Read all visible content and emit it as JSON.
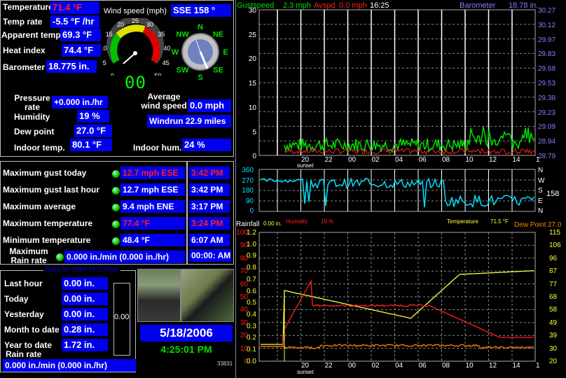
{
  "current": {
    "temperature_label": "Temperature",
    "temperature": "71.4 °F",
    "temp_rate_label": "Temp rate",
    "temp_rate": "-5.5 °F /hr",
    "apparent_label": "Apparent temp.",
    "apparent": "69.3 °F",
    "heat_index_label": "Heat index",
    "heat_index": "74.4 °F",
    "barometer_label": "Barometer",
    "barometer": "18.775 in.",
    "wind_speed_label": "Wind speed (mph)",
    "wind_dir": "SSE  158 °",
    "digital_speed": "00",
    "pressure_rate_label": "Pressure rate",
    "pressure_rate": "+0.000 in./hr",
    "humidity_label": "Humidity",
    "humidity": "19 %",
    "dew_point_label": "Dew point",
    "dew_point": "27.0 °F",
    "indoor_temp_label": "Indoor temp.",
    "indoor_temp": "80.1 °F",
    "avg_wind_label": "Average wind speed",
    "avg_wind": "0.0 mph",
    "windrun": "Windrun 22.9 miles",
    "indoor_hum_label": "Indoor hum.",
    "indoor_hum": "24 %"
  },
  "gauge": {
    "scale": [
      "0",
      "5",
      "10",
      "15",
      "20",
      "25",
      "30",
      "35",
      "40",
      "45",
      "50"
    ]
  },
  "compass": {
    "points": [
      "N",
      "NE",
      "E",
      "SE",
      "S",
      "SW",
      "W",
      "NW"
    ]
  },
  "extremes": [
    {
      "label": "Maximum gust today",
      "value": "12.7 mph ESE",
      "time": "3:42 PM",
      "red": true
    },
    {
      "label": "Maximum gust last hour",
      "value": "12.7 mph ESE",
      "time": "3:42 PM",
      "red": false
    },
    {
      "label": "Maximum average",
      "value": "9.4 mph ENE",
      "time": "3:17 PM",
      "red": false
    },
    {
      "label": "Maximum temperature",
      "value": "77.4 °F",
      "time": "3:24 PM",
      "red": true
    },
    {
      "label": "Minimum temperature",
      "value": "48.4 °F",
      "time": "6:07 AM",
      "red": false
    }
  ],
  "max_rain": {
    "label": "Maximum Rain rate",
    "value": "0.000 in./min (0.000 in./hr)",
    "time": "00:00: AM"
  },
  "rain": {
    "title": "Rain to start of 0 hour",
    "rows": [
      {
        "label": "Last hour",
        "value": "0.00 in."
      },
      {
        "label": "Today",
        "value": "0.00 in."
      },
      {
        "label": "Yesterday",
        "value": "0.00 in."
      },
      {
        "label": "Month to date",
        "value": "0.28 in."
      },
      {
        "label": "Year to date",
        "value": "1.72 in."
      }
    ],
    "gauge_value": "0.00",
    "rate_label": "Rain rate",
    "rate_value": "0.000 in./min (0.000 in./hr)"
  },
  "date": "5/18/2006",
  "time": "4:25:01 PM",
  "counter": "33831",
  "colors": {
    "panel_blue": "#0000ee",
    "red": "#ff2020",
    "green": "#00dd00",
    "cyan": "#00e0ff",
    "yellow": "#ffff40",
    "orange": "#ff8000"
  },
  "wind_graph": {
    "gust_label": "Gustspeed",
    "gust_value": "2.3 mph",
    "avg_label": "Avspd",
    "avg_value": "0.0 mph",
    "time": "16:25",
    "baro_label": "Barometer",
    "baro_value": "18.78 in.",
    "speed_ticks": [
      "30",
      "25",
      "20",
      "15",
      "10",
      "5",
      "0"
    ],
    "baro_ticks": [
      "30.27",
      "30.12",
      "29.97",
      "29.83",
      "29.68",
      "29.53",
      "29.38",
      "29.23",
      "29.09",
      "28.94",
      "28.79"
    ],
    "x_ticks": [
      "20",
      "22",
      "00",
      "02",
      "04",
      "06",
      "08",
      "10",
      "12",
      "14",
      "1"
    ],
    "sunset": "sunset"
  },
  "dir_graph": {
    "left_ticks": [
      "360",
      "270",
      "180",
      "90",
      "0"
    ],
    "right_ticks": [
      "N",
      "W",
      "S",
      "E",
      "N"
    ],
    "current": "158"
  },
  "temp_graph": {
    "rainfall_label": "Rainfall",
    "rainfall_value": "0.00 in.",
    "humidity_label": "Humidity",
    "humidity_value": "19 %",
    "temp_label": "Temperature",
    "temp_value": "71.5 °F",
    "dew_label": "Dew Point",
    "dew_value": "27.0",
    "hum_ticks": [
      "100",
      "90",
      "80",
      "70",
      "60",
      "50",
      "40",
      "30",
      "20",
      "10",
      "0"
    ],
    "rain_ticks": [
      "1.2",
      "1.0",
      "0.9",
      "0.8",
      "0.7",
      "0.6",
      "0.5",
      "0.4",
      "0.3",
      "0.2",
      "0.1",
      "0.0"
    ],
    "temp_ticks": [
      "115",
      "106",
      "96",
      "87",
      "77",
      "68",
      "58",
      "49",
      "39",
      "30",
      "20"
    ],
    "x_ticks": [
      "20",
      "22",
      "00",
      "02",
      "04",
      "06",
      "08",
      "10",
      "12",
      "14",
      "1"
    ],
    "sunset": "sunset"
  }
}
